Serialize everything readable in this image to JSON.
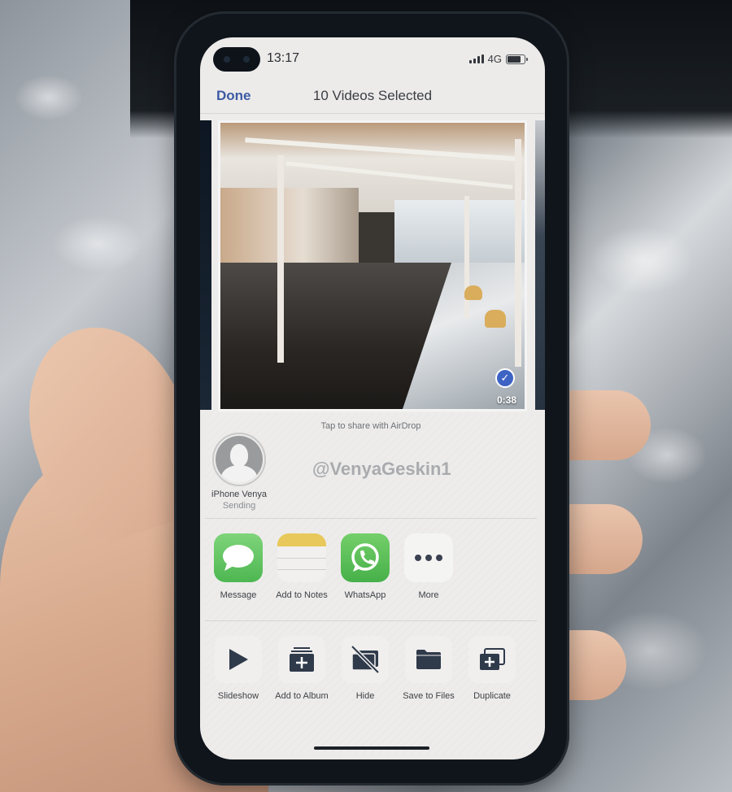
{
  "status_bar": {
    "time": "13:17",
    "network": "4G",
    "battery_level_fraction": 0.8
  },
  "nav": {
    "done_label": "Done",
    "title": "10 Videos Selected"
  },
  "carousel": {
    "selected": true,
    "duration": "0:38",
    "check_icon": "checkmark-icon",
    "accent_color": "#3d63c4"
  },
  "airdrop": {
    "hint": "Tap to share with AirDrop",
    "device_name": "iPhone Venya",
    "device_status": "Sending",
    "watermark": "@VenyaGeskin1"
  },
  "apps": [
    {
      "label": "Message",
      "icon": "message-bubble-icon"
    },
    {
      "label": "Add to Notes",
      "icon": "notes-icon"
    },
    {
      "label": "WhatsApp",
      "icon": "whatsapp-icon"
    },
    {
      "label": "More",
      "icon": "more-dots-icon"
    }
  ],
  "actions": [
    {
      "label": "Slideshow",
      "icon": "play-icon"
    },
    {
      "label": "Add to Album",
      "icon": "add-to-album-icon"
    },
    {
      "label": "Hide",
      "icon": "hide-icon"
    },
    {
      "label": "Save to Files",
      "icon": "folder-icon"
    },
    {
      "label": "Duplicate",
      "icon": "duplicate-icon"
    }
  ],
  "colors": {
    "link_blue": "#3d5aa3",
    "sheet_bg": "#edeceb",
    "icon_dark": "#2f3a4a"
  }
}
